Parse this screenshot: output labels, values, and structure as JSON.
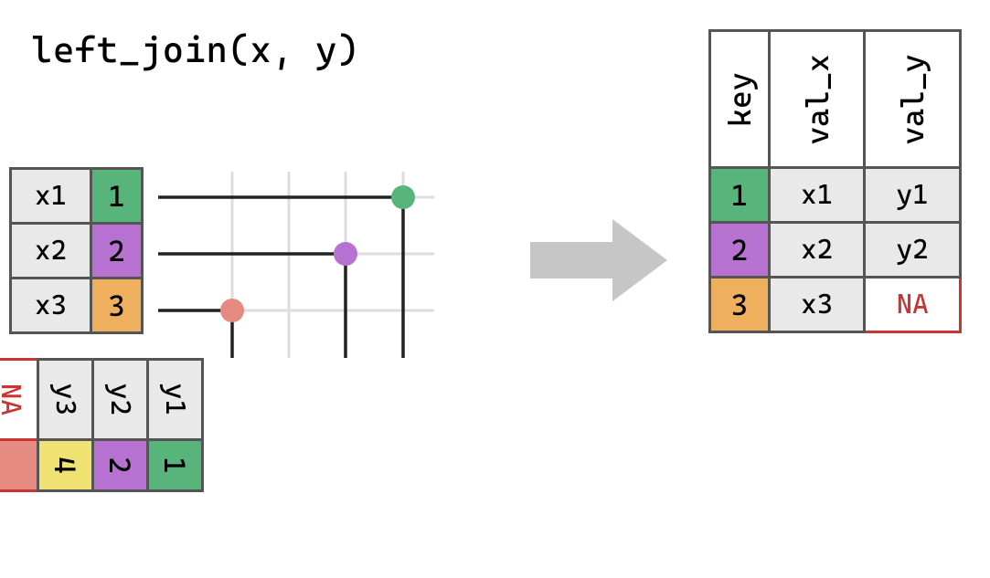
{
  "title": "left_join(x, y)",
  "x": {
    "rows": [
      {
        "val": "x1",
        "key": "1",
        "color": "k1"
      },
      {
        "val": "x2",
        "key": "2",
        "color": "k2"
      },
      {
        "val": "x3",
        "key": "3",
        "color": "k3"
      }
    ]
  },
  "y": {
    "rows": [
      {
        "val": "y1",
        "key": "1",
        "color": "k1"
      },
      {
        "val": "y2",
        "key": "2",
        "color": "k2"
      },
      {
        "val": "y3",
        "key": "4",
        "color": "k4"
      },
      {
        "val": "NA",
        "key": "",
        "color": "kna"
      }
    ]
  },
  "result": {
    "headers": [
      "key",
      "val_x",
      "val_y"
    ],
    "rows": [
      {
        "key": "1",
        "color": "k1",
        "vx": "x1",
        "vy": "y1",
        "vyna": false
      },
      {
        "key": "2",
        "color": "k2",
        "vx": "x2",
        "vy": "y2",
        "vyna": false
      },
      {
        "key": "3",
        "color": "k3",
        "vx": "x3",
        "vy": "NA",
        "vyna": true
      }
    ]
  },
  "dot_colors": {
    "k1": "#57b57b",
    "k2": "#b771d0",
    "k3": "#e48a81"
  }
}
